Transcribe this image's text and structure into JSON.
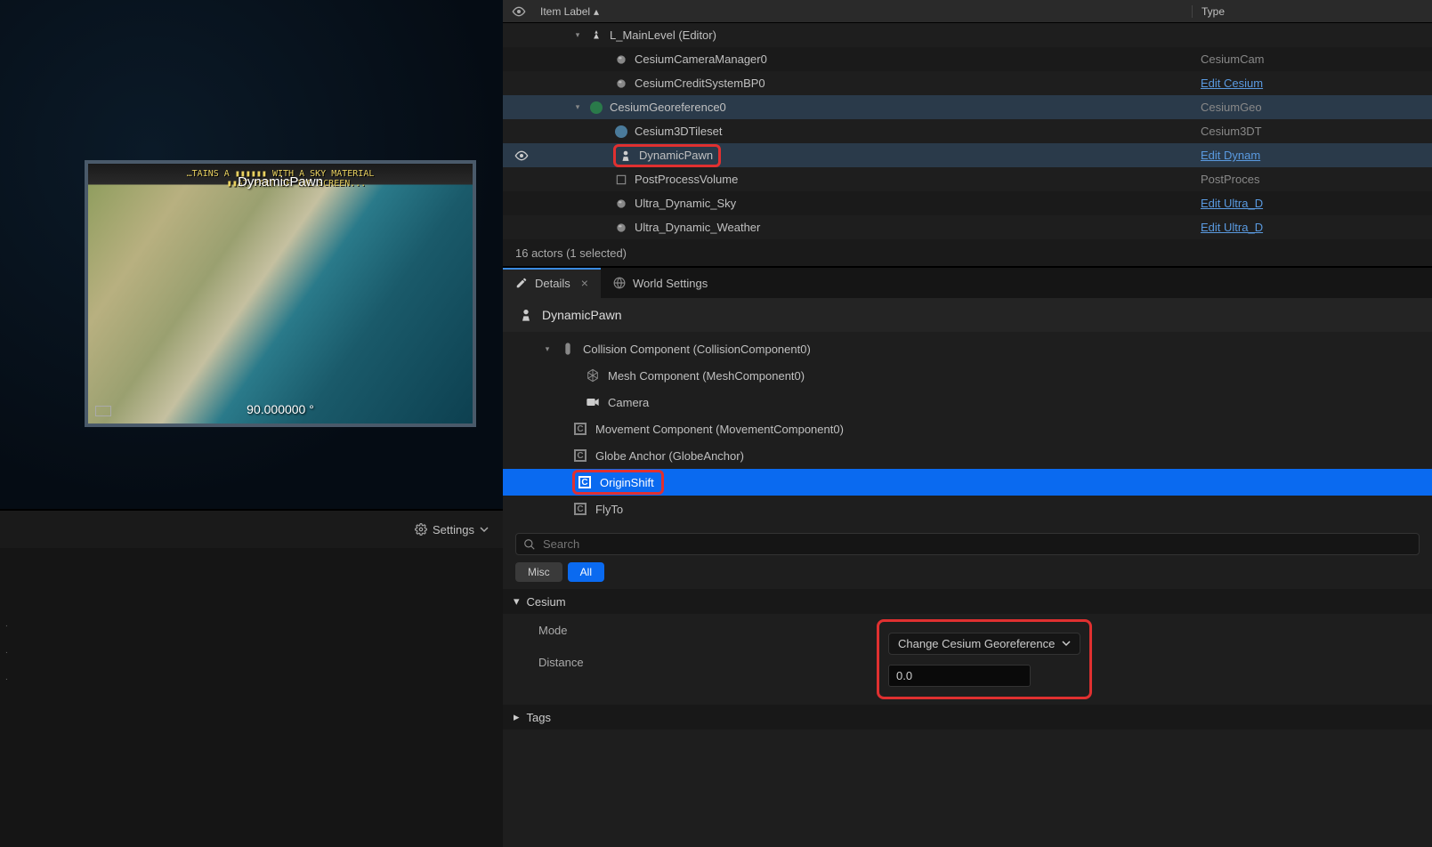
{
  "outliner": {
    "col_label": "Item Label",
    "col_type": "Type",
    "rows": [
      {
        "indent": 40,
        "icon": "world",
        "label": "L_MainLevel (Editor)",
        "type": "",
        "expander": "▾"
      },
      {
        "indent": 68,
        "icon": "sphere",
        "label": "CesiumCameraManager0",
        "type": "CesiumCam"
      },
      {
        "indent": 68,
        "icon": "sphere",
        "label": "CesiumCreditSystemBP0",
        "type": "Edit Cesium",
        "link": true
      },
      {
        "indent": 40,
        "icon": "geo",
        "label": "CesiumGeoreference0",
        "type": "CesiumGeo",
        "expander": "▾",
        "sel_bg": true
      },
      {
        "indent": 68,
        "icon": "tile",
        "label": "Cesium3DTileset",
        "type": "Cesium3DT"
      },
      {
        "indent": 68,
        "icon": "pawn",
        "label": "DynamicPawn",
        "type": "Edit Dynam",
        "link": true,
        "selected": true,
        "highlight": true,
        "eye": true
      },
      {
        "indent": 68,
        "icon": "vol",
        "label": "PostProcessVolume",
        "type": "PostProces"
      },
      {
        "indent": 68,
        "icon": "sphere",
        "label": "Ultra_Dynamic_Sky",
        "type": "Edit Ultra_D",
        "link": true
      },
      {
        "indent": 68,
        "icon": "sphere",
        "label": "Ultra_Dynamic_Weather",
        "type": "Edit Ultra_D",
        "link": true
      }
    ],
    "footer": "16 actors (1 selected)"
  },
  "viewport": {
    "overlay_text": "…TAINS A ▮▮▮▮▮▮ WITH A SKY MATERIAL\n      ▮▮AT PART OF THE SCREEN...",
    "label": "DynamicPawn",
    "heading": "90.000000 °"
  },
  "settings": {
    "label": "Settings"
  },
  "tabs": {
    "details": "Details",
    "world": "World Settings"
  },
  "details": {
    "selected": "DynamicPawn",
    "components": [
      {
        "indent": 18,
        "icon": "capsule",
        "label": "Collision Component (CollisionComponent0)",
        "expander": "▾"
      },
      {
        "indent": 46,
        "icon": "mesh",
        "label": "Mesh Component (MeshComponent0)"
      },
      {
        "indent": 46,
        "icon": "cam",
        "label": "Camera"
      },
      {
        "indent": 32,
        "icon": "c",
        "label": "Movement Component (MovementComponent0)"
      },
      {
        "indent": 32,
        "icon": "c",
        "label": "Globe Anchor (GlobeAnchor)"
      },
      {
        "indent": 32,
        "icon": "c",
        "label": "OriginShift",
        "selected": true,
        "highlight": true
      },
      {
        "indent": 32,
        "icon": "c",
        "label": "FlyTo"
      }
    ],
    "search_placeholder": "Search",
    "filters": {
      "misc": "Misc",
      "all": "All"
    },
    "cat_cesium": "Cesium",
    "props": {
      "mode_label": "Mode",
      "mode_value": "Change Cesium Georeference",
      "distance_label": "Distance",
      "distance_value": "0.0"
    },
    "cat_tags": "Tags"
  }
}
